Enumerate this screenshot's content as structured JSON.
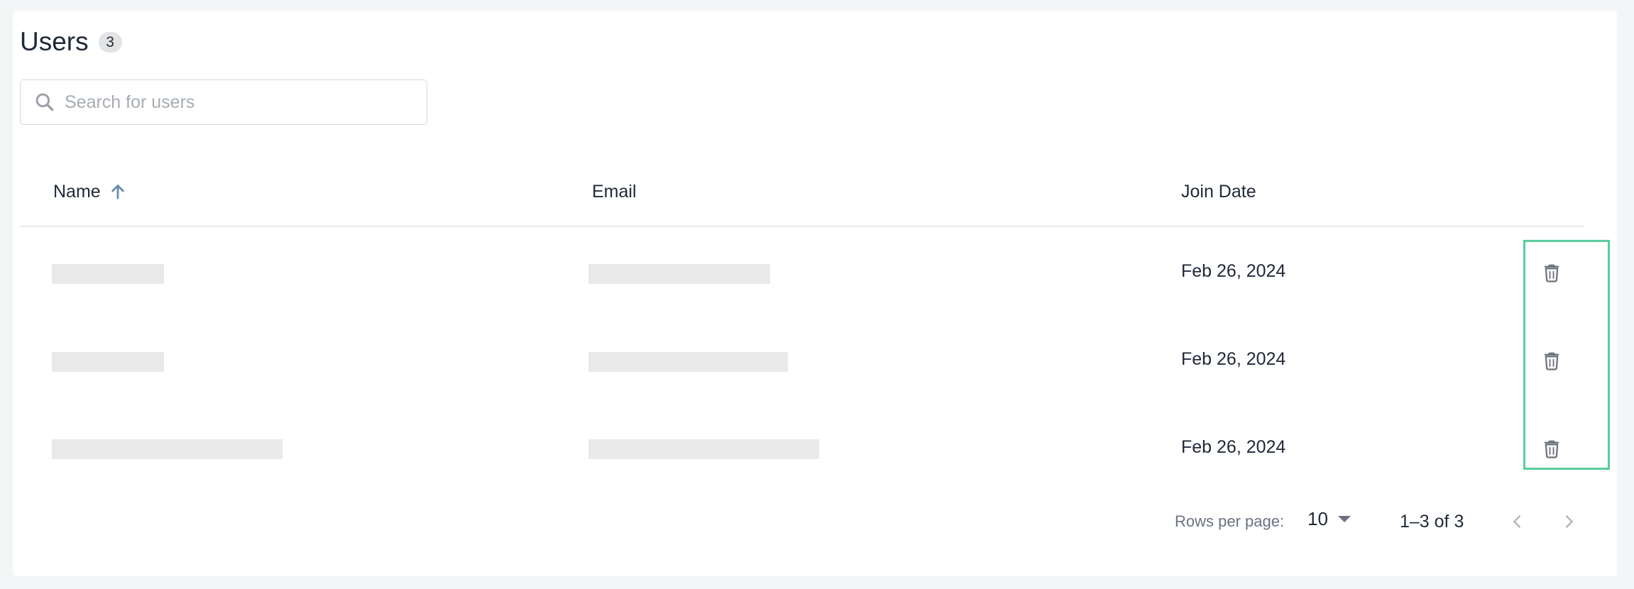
{
  "page": {
    "title": "Users",
    "count": "3"
  },
  "search": {
    "placeholder": "Search for users",
    "value": "",
    "icon": "search-icon"
  },
  "table": {
    "columns": [
      {
        "label": "Name",
        "sort": "ascending"
      },
      {
        "label": "Email"
      },
      {
        "label": "Join Date"
      }
    ],
    "rows": [
      {
        "join_date": "Feb 26, 2024"
      },
      {
        "join_date": "Feb 26, 2024"
      },
      {
        "join_date": "Feb 26, 2024"
      }
    ],
    "row_action_icon": "trash-icon"
  },
  "pagination": {
    "rows_per_page_label": "Rows per page:",
    "rows_per_page_value": "10",
    "range_text": "1–3 of 3"
  },
  "colors": {
    "highlight": "#5acd9d",
    "sort_icon": "#6a8bb0",
    "skeleton": "#e9e9e9"
  }
}
